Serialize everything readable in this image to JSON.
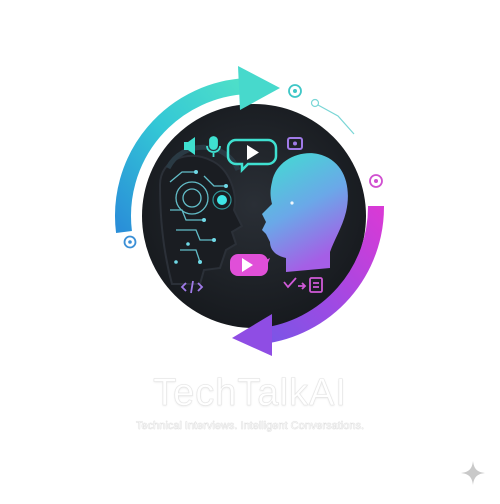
{
  "logo": {
    "brand_name": "TechTalkAI",
    "tagline": "Technical Interviews. Intelligent Conversations.",
    "icons": [
      "microphone-icon",
      "volume-icon",
      "play-icon",
      "chat-bubble-icon",
      "code-icon",
      "checklist-icon",
      "sparkle-icon"
    ]
  },
  "colors": {
    "cyan": "#2fd3d3",
    "teal": "#38c6b8",
    "purple": "#8a4fe0",
    "magenta": "#d03ad0",
    "dark": "#1c1f24"
  }
}
